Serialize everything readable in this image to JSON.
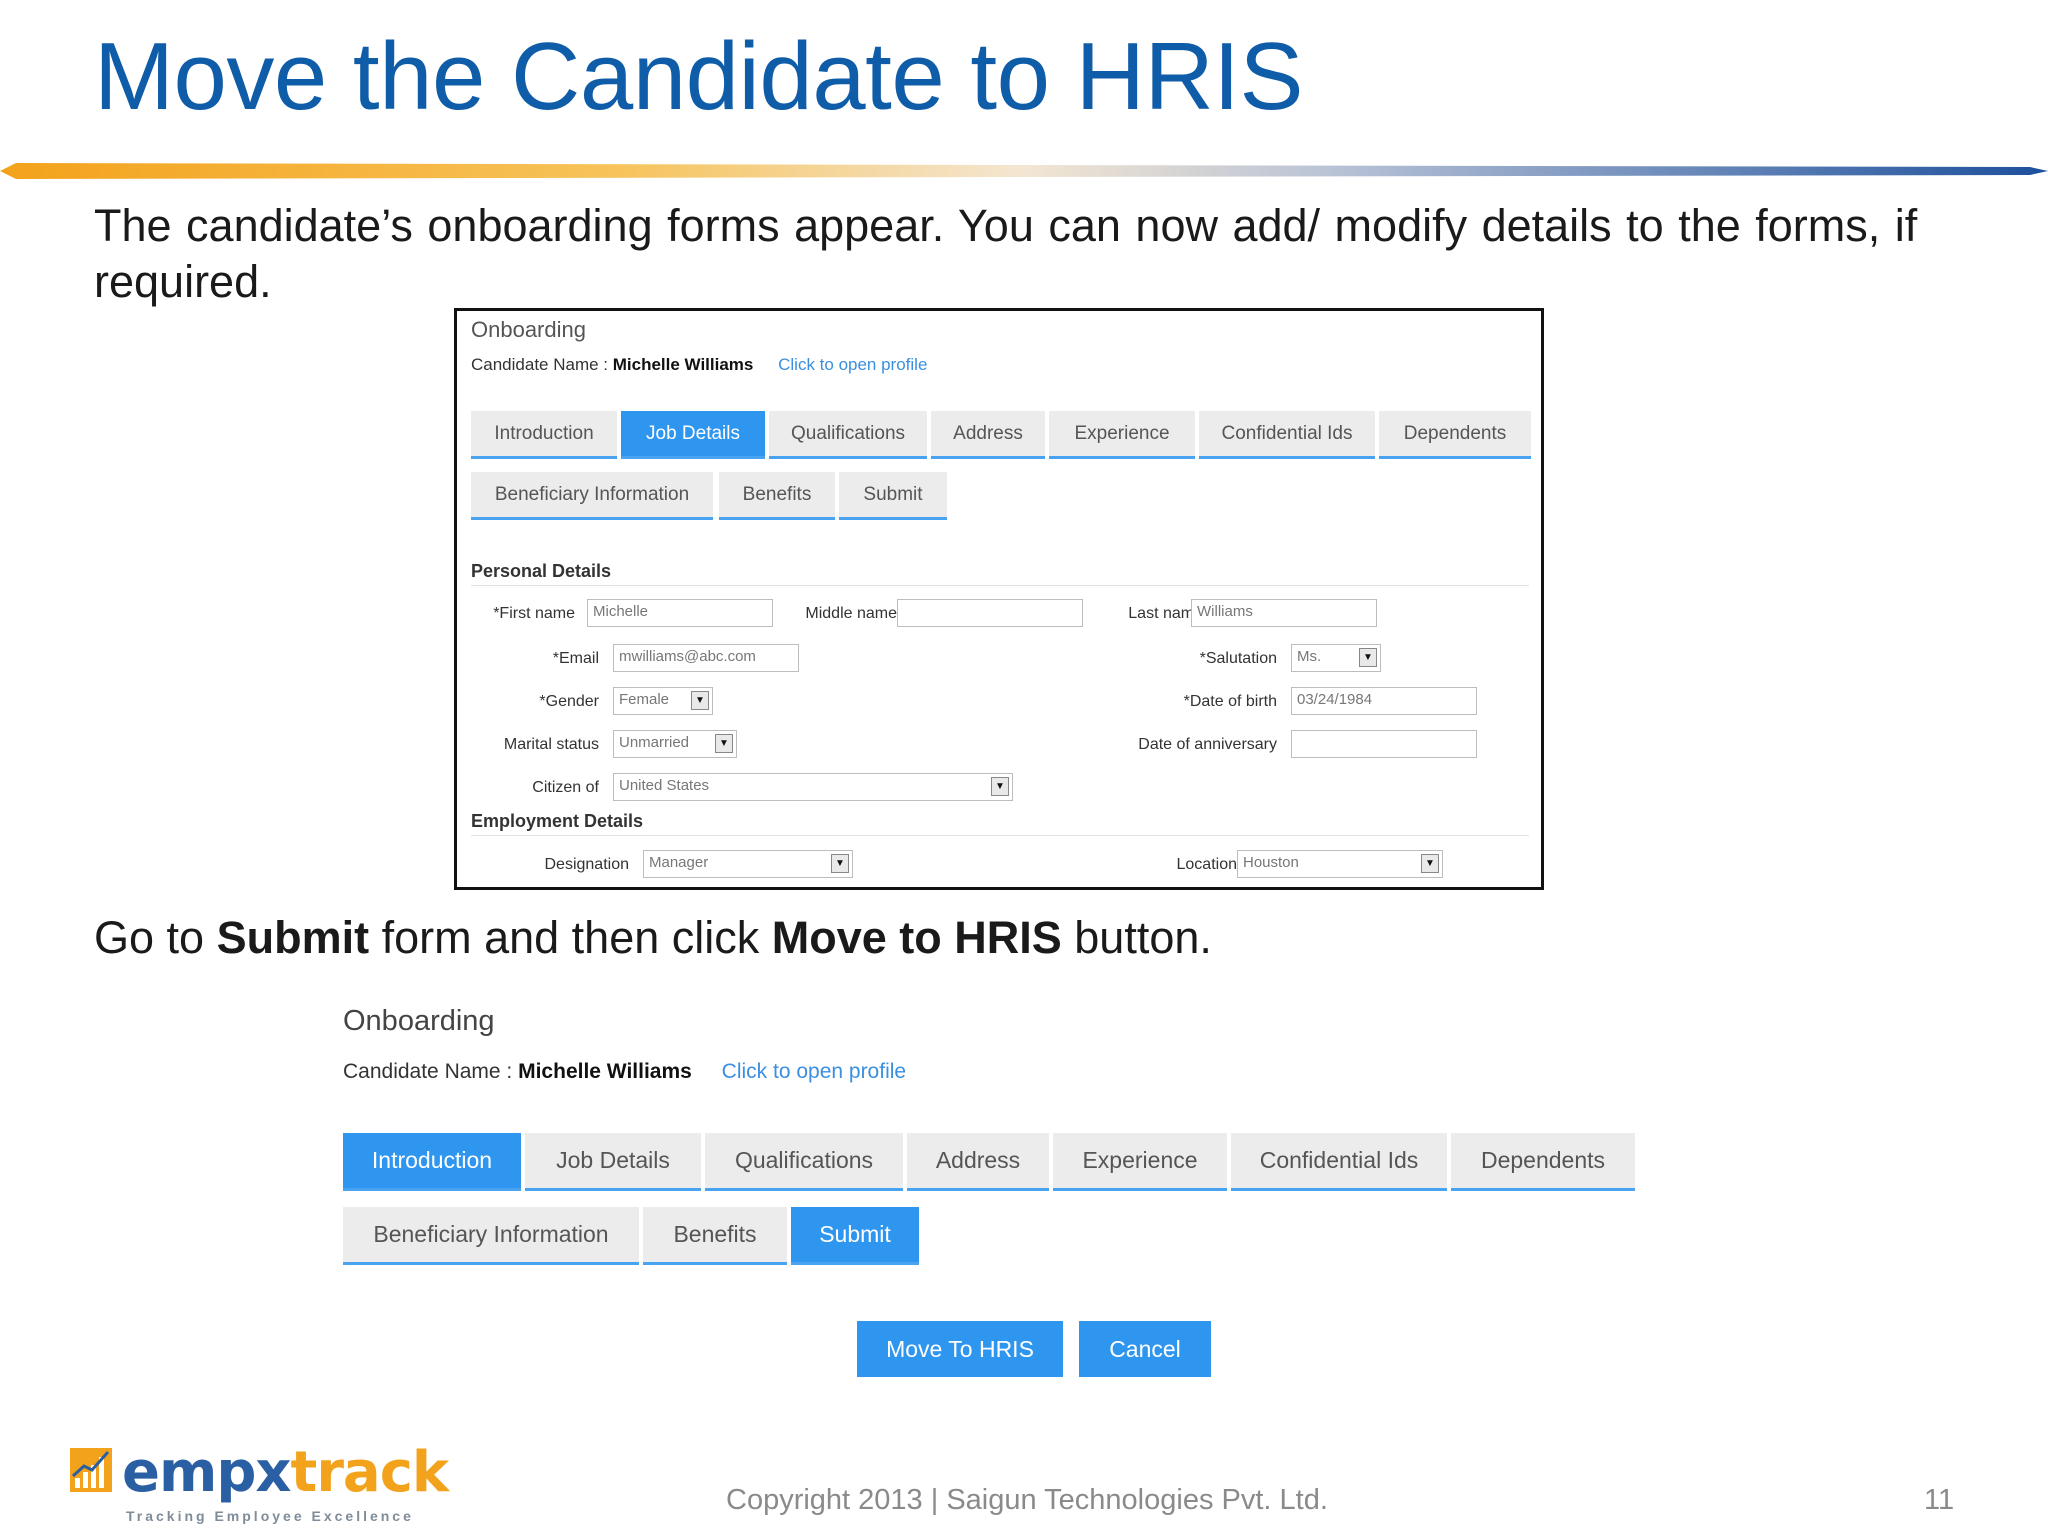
{
  "slide": {
    "title": "Move the Candidate to HRIS",
    "intro": "The candidate’s onboarding forms appear. You can now add/ modify details to the forms, if required.",
    "instruction": {
      "pre": "Go to ",
      "submit_word": "Submit",
      "mid": " form and then click ",
      "button_word": "Move to HRIS",
      "post": " button."
    }
  },
  "shot1": {
    "title": "Onboarding",
    "candidate_label": "Candidate Name : ",
    "candidate_name": "Michelle Williams",
    "profile_link": "Click to open profile",
    "tabs_row1": [
      "Introduction",
      "Job Details",
      "Qualifications",
      "Address",
      "Experience",
      "Confidential Ids",
      "Dependents"
    ],
    "tabs_row2": [
      "Beneficiary Information",
      "Benefits",
      "Submit"
    ],
    "active_tab": "Job Details",
    "personal_heading": "Personal Details",
    "employment_heading": "Employment Details",
    "fields": {
      "first_name": {
        "label": "*First name",
        "value": "Michelle"
      },
      "middle_name": {
        "label": "Middle name",
        "value": ""
      },
      "last_name": {
        "label": "Last name",
        "value": "Williams"
      },
      "email": {
        "label": "*Email",
        "value": "mwilliams@abc.com"
      },
      "salutation": {
        "label": "*Salutation",
        "value": "Ms."
      },
      "gender": {
        "label": "*Gender",
        "value": "Female"
      },
      "dob": {
        "label": "*Date of birth",
        "value": "03/24/1984"
      },
      "marital": {
        "label": "Marital status",
        "value": "Unmarried"
      },
      "anniversary": {
        "label": "Date of anniversary",
        "value": ""
      },
      "citizen": {
        "label": "Citizen of",
        "value": "United States"
      },
      "designation": {
        "label": "Designation",
        "value": "Manager"
      },
      "location": {
        "label": "Location",
        "value": "Houston"
      }
    }
  },
  "shot2": {
    "title": "Onboarding",
    "candidate_label": "Candidate Name : ",
    "candidate_name": "Michelle Williams",
    "profile_link": "Click to open profile",
    "tabs_row1": [
      "Introduction",
      "Job Details",
      "Qualifications",
      "Address",
      "Experience",
      "Confidential Ids",
      "Dependents"
    ],
    "tabs_row2": [
      "Beneficiary Information",
      "Benefits",
      "Submit"
    ],
    "active_tabs": [
      "Introduction",
      "Submit"
    ],
    "move_button": "Move To HRIS",
    "cancel_button": "Cancel"
  },
  "footer": {
    "logo_part1": "empx",
    "logo_part2": "track",
    "tagline": "Tracking Employee Excellence",
    "copyright": "Copyright 2013 | Saigun Technologies Pvt. Ltd.",
    "page_number": "11"
  },
  "colors": {
    "title_blue": "#0f5ca8",
    "accent_blue": "#2f96f0",
    "tab_underline": "#4aa3f0",
    "link_blue": "#3b8fe0",
    "logo_orange": "#f3a21b"
  }
}
